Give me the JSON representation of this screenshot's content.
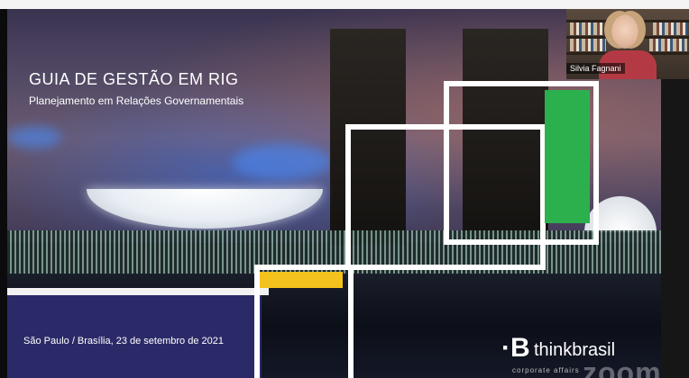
{
  "slide": {
    "title": "GUIA DE GESTÃO EM RIG",
    "subtitle": "Planejamento em Relações Governamentais",
    "date": "São Paulo / Brasília, 23 de setembro de 2021"
  },
  "logo": {
    "mark": "·B",
    "name": "thinkbrasil",
    "tagline": "corporate affairs",
    "watermark": "zoom"
  },
  "participant": {
    "name": "Silvia Fagnani"
  },
  "colors": {
    "navy": "#2b2a68",
    "green": "#2cb04d",
    "yellow": "#f3c21c",
    "white": "#ffffff"
  }
}
